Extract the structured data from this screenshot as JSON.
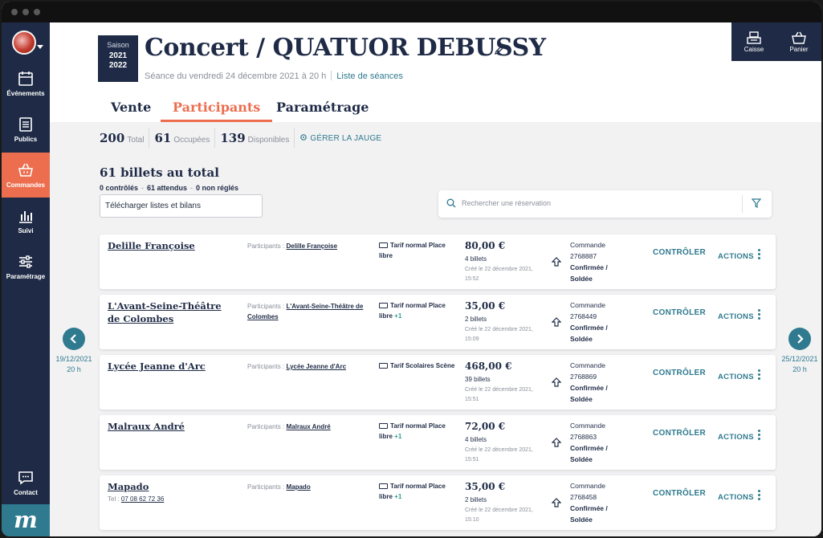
{
  "sidebar": {
    "items": [
      {
        "label": "Événements",
        "icon": "calendar-icon"
      },
      {
        "label": "Publics",
        "icon": "list-icon"
      },
      {
        "label": "Commandes",
        "icon": "basket-icon",
        "active": true
      },
      {
        "label": "Suivi",
        "icon": "bar-chart-icon"
      },
      {
        "label": "Paramétrage",
        "icon": "sliders-icon"
      }
    ],
    "contact_label": "Contact",
    "logo": "m"
  },
  "header": {
    "season_label": "Saison",
    "season_year_start": "2021",
    "season_year_end": "2022",
    "title": "Concert / QUATUOR DEBUSSY",
    "subtitle": "Séance du vendredi 24 décembre 2021 à 20 h",
    "sessions_link": "Liste de séances",
    "caisse_label": "Caisse",
    "panier_label": "Panier"
  },
  "tabs": [
    {
      "label": "Vente",
      "active": false
    },
    {
      "label": "Participants",
      "active": true
    },
    {
      "label": "Paramétrage",
      "active": false
    }
  ],
  "stats": {
    "total_num": "200",
    "total_label": "Total",
    "occupied_num": "61",
    "occupied_label": "Occupées",
    "available_num": "139",
    "available_label": "Disponibles",
    "gauge_link": "GÉRER LA JAUGE"
  },
  "summary": {
    "title": "61 billets au total",
    "controlled": "0 contrôlés",
    "expected": "61 attendus",
    "unpaid": "0 non réglés",
    "download_button": "Télécharger listes et bilans"
  },
  "search": {
    "placeholder": "Rechercher une réservation"
  },
  "navigation": {
    "prev_date": "19/12/2021",
    "prev_time": "20 h",
    "next_date": "25/12/2021",
    "next_time": "20 h"
  },
  "labels": {
    "participants_prefix": "Participants :",
    "control": "CONTRÔLER",
    "actions": "ACTIONS"
  },
  "rows": [
    {
      "name": "Delille Françoise",
      "tel": "",
      "participant": "Delille Françoise",
      "tarif": "Tarif normal Place libre",
      "extra": "",
      "amount": "80,00 €",
      "tickets": "4 billets",
      "created": "Créé le 22 décembre 2021, 15:52",
      "order_label": "Commande",
      "order_num": "2768887",
      "status": "Confirmée / Soldée"
    },
    {
      "name": "L'Avant-Seine-Théâtre de Colombes",
      "tel": "",
      "participant": "L'Avant-Seine-Théâtre de Colombes",
      "tarif": "Tarif normal Place libre",
      "extra": "+1",
      "amount": "35,00 €",
      "tickets": "2 billets",
      "created": "Créé le 22 décembre 2021, 15:09",
      "order_label": "Commande",
      "order_num": "2768449",
      "status": "Confirmée / Soldée"
    },
    {
      "name": "Lycée Jeanne d'Arc",
      "tel": "",
      "participant": "Lycée Jeanne d'Arc",
      "tarif": "Tarif Scolaires Scène",
      "extra": "",
      "amount": "468,00 €",
      "tickets": "39 billets",
      "created": "Créé le 22 décembre 2021, 15:51",
      "order_label": "Commande",
      "order_num": "2768869",
      "status": "Confirmée / Soldée"
    },
    {
      "name": "Malraux André",
      "tel": "",
      "participant": "Malraux André",
      "tarif": "Tarif normal Place libre",
      "extra": "+1",
      "amount": "72,00 €",
      "tickets": "4 billets",
      "created": "Créé le 22 décembre 2021, 15:51",
      "order_label": "Commande",
      "order_num": "2768863",
      "status": "Confirmée / Soldée"
    },
    {
      "name": "Mapado",
      "tel": "07 08 62 72 36",
      "tel_prefix": "Tel :",
      "participant": "Mapado",
      "tarif": "Tarif normal Place libre",
      "extra": "+1",
      "amount": "35,00 €",
      "tickets": "2 billets",
      "created": "Créé le 22 décembre 2021, 15:10",
      "order_label": "Commande",
      "order_num": "2768458",
      "status": "Confirmée / Soldée"
    }
  ],
  "colors": {
    "navy": "#1f2b46",
    "accent": "#ec6e4f",
    "teal": "#2f7a8f"
  }
}
